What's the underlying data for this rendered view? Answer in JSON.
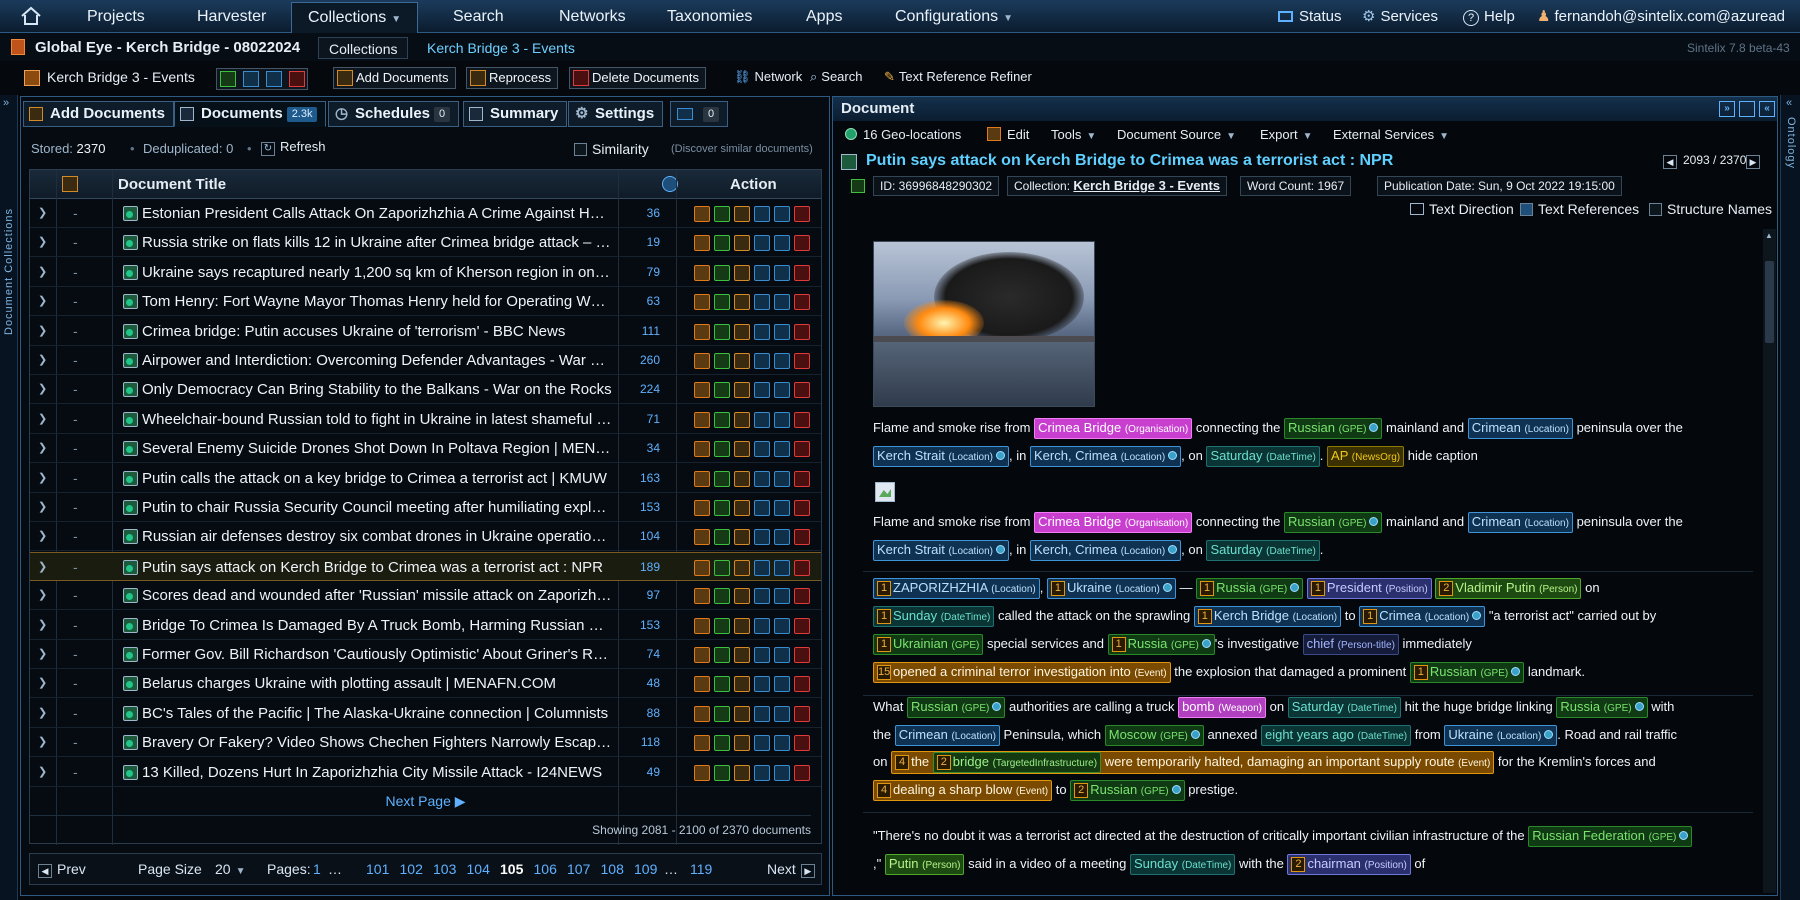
{
  "topnav": {
    "items": [
      {
        "label": "Projects"
      },
      {
        "label": "Harvester"
      },
      {
        "label": "Collections"
      },
      {
        "label": "Search"
      },
      {
        "label": "Networks"
      },
      {
        "label": "Taxonomies"
      },
      {
        "label": "Apps"
      },
      {
        "label": "Configurations"
      }
    ],
    "status": "Status",
    "services": "Services",
    "help": "Help",
    "user": "fernandoh@sintelix.com@azuread"
  },
  "breadcrumb": {
    "project": "Global Eye - Kerch Bridge - 08022024",
    "collections": "Collections",
    "current": "Kerch Bridge 3 - Events",
    "version": "Sintelix 7.8 beta-43"
  },
  "toolbar": {
    "collection": "Kerch Bridge 3 - Events",
    "add_documents": "Add Documents",
    "reprocess": "Reprocess",
    "delete_documents": "Delete Documents",
    "network": "Network",
    "search": "Search",
    "text_reference_refiner": "Text Reference Refiner"
  },
  "side": {
    "left": "Document Collections",
    "right": "Ontology"
  },
  "tabs": [
    {
      "label": "Add Documents"
    },
    {
      "label": "Documents",
      "badge": "2.3k"
    },
    {
      "label": "Schedules",
      "badge": "0"
    },
    {
      "label": "Summary"
    },
    {
      "label": "Settings"
    },
    {
      "label": "",
      "badge": "0"
    }
  ],
  "stats": {
    "stored_label": "Stored:",
    "stored": "2370",
    "dedup_label": "Deduplicated:",
    "dedup": "0",
    "refresh": "Refresh",
    "similarity": "Similarity",
    "discover": "(Discover similar documents)"
  },
  "grid": {
    "col_title": "Document Title",
    "col_action": "Action",
    "dash": "-",
    "rows": [
      {
        "title": "Estonian President Calls Attack On Zaporizhzhia A Crime Against Humanity",
        "count": "36"
      },
      {
        "title": "Russia strike on flats kills 12 in Ukraine after Crimea bridge attack – BBC News",
        "count": "19"
      },
      {
        "title": "Ukraine says recaptured nearly 1,200 sq km of Kherson region in ongoing offensive",
        "count": "79"
      },
      {
        "title": "Tom Henry: Fort Wayne Mayor Thomas Henry held for Operating While Intoxicated",
        "count": "63"
      },
      {
        "title": "Crimea bridge: Putin accuses Ukraine of 'terrorism' - BBC News",
        "count": "111"
      },
      {
        "title": "Airpower and Interdiction: Overcoming Defender Advantages - War on the Rocks",
        "count": "260"
      },
      {
        "title": "Only Democracy Can Bring Stability to the Balkans - War on the Rocks",
        "count": "224"
      },
      {
        "title": "Wheelchair-bound Russian told to fight in Ukraine in latest shameful case",
        "count": "71"
      },
      {
        "title": "Several Enemy Suicide Drones Shot Down In Poltava Region | MENAFN.COM",
        "count": "34"
      },
      {
        "title": "Putin calls the attack on a key bridge to Crimea a terrorist act | KMUW",
        "count": "163"
      },
      {
        "title": "Putin to chair Russia Security Council meeting after humiliating explosion",
        "count": "153"
      },
      {
        "title": "Russian air defenses destroy six combat drones in Ukraine operation area",
        "count": "104"
      },
      {
        "title": "Putin says attack on Kerch Bridge to Crimea was a terrorist act : NPR",
        "count": "189"
      },
      {
        "title": "Scores dead and wounded after 'Russian' missile attack on Zaporizhzhia",
        "count": "97"
      },
      {
        "title": "Bridge To Crimea Is Damaged By A Truck Bomb, Harming Russian Supply",
        "count": "153"
      },
      {
        "title": "Former Gov. Bill Richardson 'Cautiously Optimistic' About Griner's Release",
        "count": "74"
      },
      {
        "title": "Belarus charges Ukraine with plotting assault | MENAFN.COM",
        "count": "48"
      },
      {
        "title": "BC's Tales of the Pacific | The Alaska-Ukraine connection | Columnists",
        "count": "88"
      },
      {
        "title": "Bravery Or Fakery? Video Shows Chechen Fighters Narrowly Escape Attack",
        "count": "118"
      },
      {
        "title": "13 Killed, Dozens Hurt In Zaporizhzhia City Missile Attack - I24NEWS",
        "count": "49"
      }
    ],
    "next_page": "Next Page ▶",
    "showing": "Showing 2081 - 2100 of 2370 documents"
  },
  "pager": {
    "prev": "Prev",
    "page_size_label": "Page Size",
    "page_size": "20",
    "pages_label": "Pages:",
    "p1": "1",
    "ellipsis": "…",
    "pages": [
      "101",
      "102",
      "103",
      "104",
      "105",
      "106",
      "107",
      "108",
      "109"
    ],
    "last": "119",
    "next": "Next"
  },
  "doc": {
    "header": "Document",
    "geo": "16 Geo-locations",
    "edit": "Edit",
    "tools": "Tools",
    "source": "Document Source",
    "export": "Export",
    "external": "External Services",
    "title": "Putin says attack on Kerch Bridge to Crimea was a terrorist act : NPR",
    "position": "2093 / 2370",
    "id": "ID: 36996848290302",
    "collection_label": "Collection:",
    "collection": "Kerch Bridge 3 - Events",
    "word_count": "Word Count: 1967",
    "pub_date": "Publication Date: Sun, 9 Oct 2022 19:15:00",
    "text_direction": "Text Direction",
    "text_refs": "Text References",
    "structure_names": "Structure Names"
  },
  "colors": {
    "accent": "#1e5a8c",
    "org": "#c83fd0",
    "gpe": "#2a8a2a",
    "location": "#3f94d8",
    "event": "#e0960f"
  },
  "t": {
    "flame": "Flame and smoke rise from",
    "crimea_bridge": "Crimea Bridge",
    "organisation": "(Organisation)",
    "connecting": "connecting the",
    "russian": "Russian",
    "gpe": "(GPE)",
    "mainland": "mainland and",
    "crimean": "Crimean",
    "location": "(Location)",
    "peninsula": "peninsula over the",
    "kerch_strait": "Kerch Strait",
    "comma_in": ", in",
    "kerch_crimea": "Kerch, Crimea",
    "comma_on": ", on",
    "saturday": "Saturday",
    "datetime": "(DateTime)",
    "dot": ".",
    "ap": "AP",
    "newsorg": "(NewsOrg)",
    "hide_caption": "hide caption",
    "zaporizhzhia": "ZAPORIZHZHIA",
    "ukraine": "Ukraine",
    "dash": "—",
    "russia": "Russia",
    "president": "President",
    "position": "(Position)",
    "vladimir_putin": "Vladimir Putin",
    "person": "(Person)",
    "on": "on",
    "sunday": "Sunday",
    "called": "called the attack on the sprawling",
    "kerch_bridge": "Kerch Bridge",
    "to": "to",
    "crimea": "Crimea",
    "terrorist": "\"a terrorist act\" carried out by",
    "ukrainian": "Ukrainian",
    "special": "special services and",
    "investigative": "'s investigative",
    "chief": "chief",
    "persontitle": "(Person-title)",
    "immediately": "immediately",
    "opened": "opened a criminal terror investigation into",
    "event": "(Event)",
    "explosion": "the explosion that damaged a prominent",
    "landmark": "landmark.",
    "what": "What",
    "authorities": "authorities are calling a truck",
    "bomb": "bomb",
    "weapon": "(Weapon)",
    "hit": "hit the huge bridge linking",
    "with": "with",
    "the": "the",
    "peninsula_which": "Peninsula, which",
    "moscow": "Moscow",
    "annexed": "annexed",
    "eight_years": "eight years ago",
    "from": "from",
    "road_rail": ". Road and rail traffic",
    "the2": "the",
    "bridge": "bridge",
    "targeted": "(TargetedInfrastructure)",
    "halted": "were temporarily halted, damaging an important supply route",
    "kremlin": "for the Kremlin's forces and",
    "dealing": "dealing a sharp blow",
    "prestige": "prestige.",
    "no_doubt": "\"There's no doubt it was a terrorist act directed at the destruction of critically important civilian infrastructure of the",
    "russian_fed": "Russian Federation",
    "quote_comma": ",\"",
    "putin": "Putin",
    "said": "said in a video of a meeting",
    "sunday2": "Sunday",
    "with_the": "with the",
    "chairman": "chairman",
    "of": "of"
  }
}
